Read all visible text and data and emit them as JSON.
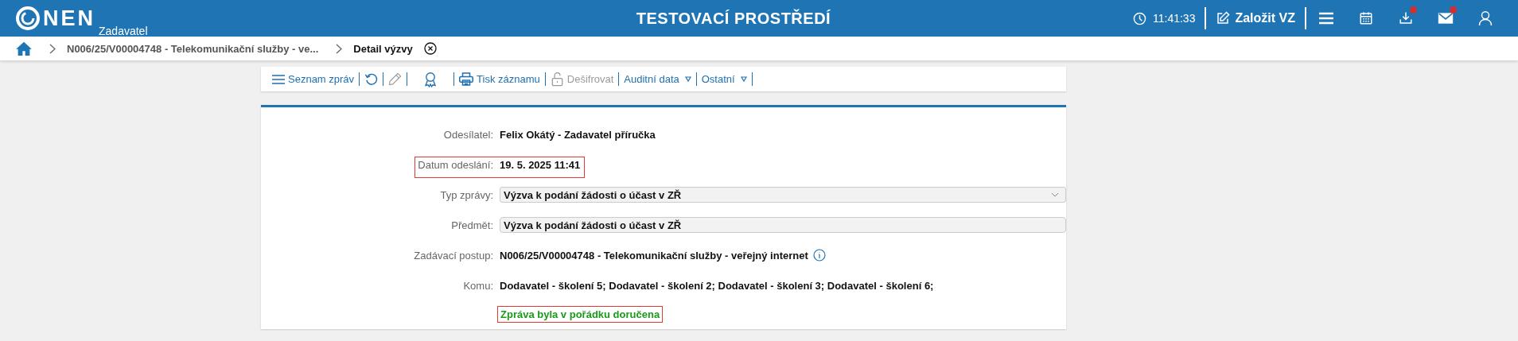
{
  "header": {
    "logo": {
      "name": "NEN",
      "subtitle": "Zadavatel"
    },
    "environment_title": "TESTOVACÍ PROSTŘEDÍ",
    "clock_time": "11:41:33",
    "create_button": "Založit VZ",
    "icons": [
      {
        "kind": "menu",
        "badge": false
      },
      {
        "kind": "calendar",
        "badge": false
      },
      {
        "kind": "download",
        "badge": true
      },
      {
        "kind": "mail",
        "badge": true
      },
      {
        "kind": "user",
        "badge": false
      }
    ]
  },
  "breadcrumb": {
    "items": [
      {
        "kind": "home"
      },
      {
        "kind": "link",
        "label": "N006/25/V00004748 - Telekomunikační služby - ve..."
      },
      {
        "kind": "current",
        "label": "Detail výzvy"
      }
    ]
  },
  "toolbar": {
    "items": [
      {
        "kind": "list",
        "label": "Seznam zpráv",
        "disabled": false,
        "dropdown": false
      },
      {
        "kind": "refresh",
        "disabled": false,
        "dropdown": false
      },
      {
        "kind": "edit",
        "disabled": true,
        "dropdown": false
      },
      {
        "kind": "award",
        "disabled": false,
        "dropdown": false
      },
      {
        "kind": "print",
        "label": "Tisk záznamu",
        "disabled": false,
        "dropdown": false
      },
      {
        "kind": "lock",
        "label": "Dešifrovat",
        "disabled": true,
        "dropdown": false
      },
      {
        "kind": "text",
        "label": "Auditní data",
        "disabled": false,
        "dropdown": true
      },
      {
        "kind": "text",
        "label": "Ostatní",
        "disabled": false,
        "dropdown": true
      }
    ]
  },
  "form": {
    "fields": [
      {
        "kind": "text",
        "label": "Odesílatel:",
        "value": "Felix Okátý - Zadavatel příručka",
        "highlighted": false
      },
      {
        "kind": "text",
        "label": "Datum odeslání:",
        "value": "19. 5. 2025 11:41",
        "highlighted": true
      },
      {
        "kind": "select",
        "label": "Typ zprávy:",
        "value": "Výzva k podání žádosti o účast v ZŘ",
        "highlighted": false
      },
      {
        "kind": "input",
        "label": "Předmět:",
        "value": "Výzva k podání žádosti o účast v ZŘ",
        "highlighted": false
      },
      {
        "kind": "info",
        "label": "Zadávací postup:",
        "value": "N006/25/V00004748 - Telekomunikační služby - veřejný internet",
        "highlighted": false
      },
      {
        "kind": "text",
        "label": "Komu:",
        "value": "Dodavatel - školení 5; Dodavatel - školení 2; Dodavatel - školení 3; Dodavatel - školení 6;",
        "highlighted": false
      }
    ],
    "status_message": {
      "text": "Zpráva byla v pořádku doručena",
      "highlighted": true
    }
  }
}
